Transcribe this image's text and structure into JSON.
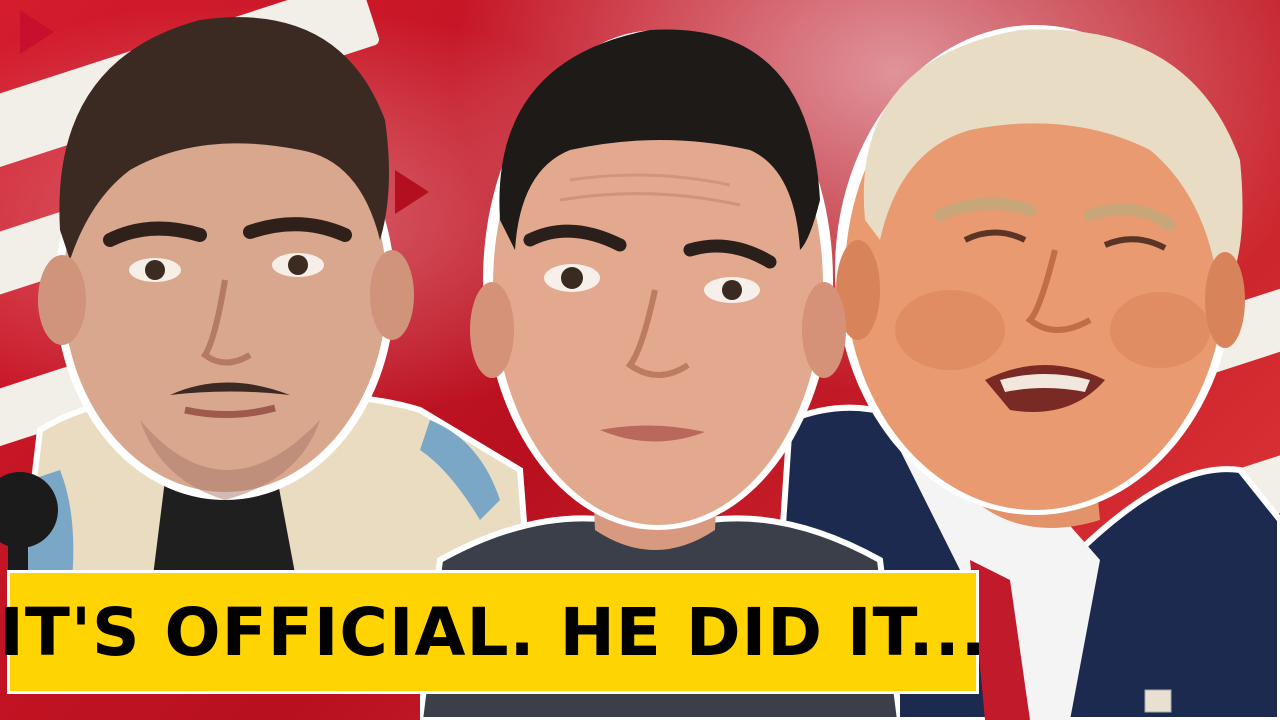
{
  "thumbnail": {
    "caption": "IT'S OFFICIAL. HE DID IT...",
    "caption_background": "#ffd400",
    "caption_color": "#000000",
    "background_color": "#c8102e"
  },
  "figures": [
    {
      "name": "left-person",
      "suit_color": "#1f1f1f"
    },
    {
      "name": "center-person",
      "shirt_color": "#3b3f4a"
    },
    {
      "name": "right-person",
      "suit_color": "#1c2a4f",
      "tie_color": "#c11a2a"
    }
  ]
}
